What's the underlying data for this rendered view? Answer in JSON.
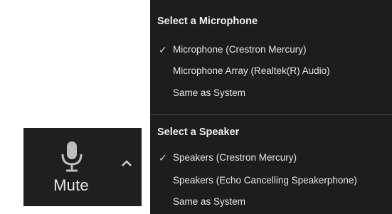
{
  "toolbar": {
    "mute_label": "Mute",
    "caret_glyph": "^",
    "icons": {
      "mic": "microphone-icon",
      "caret": "chevron-up-icon"
    }
  },
  "menu": {
    "microphone": {
      "title": "Select a Microphone",
      "items": [
        {
          "label": "Microphone (Crestron Mercury)",
          "selected": true,
          "check": "✓"
        },
        {
          "label": "Microphone Array (Realtek(R) Audio)",
          "selected": false,
          "check": ""
        },
        {
          "label": "Same as System",
          "selected": false,
          "check": ""
        }
      ]
    },
    "speaker": {
      "title": "Select a Speaker",
      "items": [
        {
          "label": "Speakers (Crestron Mercury)",
          "selected": true,
          "check": "✓"
        },
        {
          "label": "Speakers (Echo Cancelling Speakerphone)",
          "selected": false,
          "check": ""
        },
        {
          "label": "Same as System",
          "selected": false,
          "check": ""
        }
      ]
    }
  },
  "colors": {
    "menu_bg": "#1d1d1d",
    "toolbar_bg": "#1f1f1f",
    "text": "#e6e6e6",
    "divider": "#474747"
  }
}
